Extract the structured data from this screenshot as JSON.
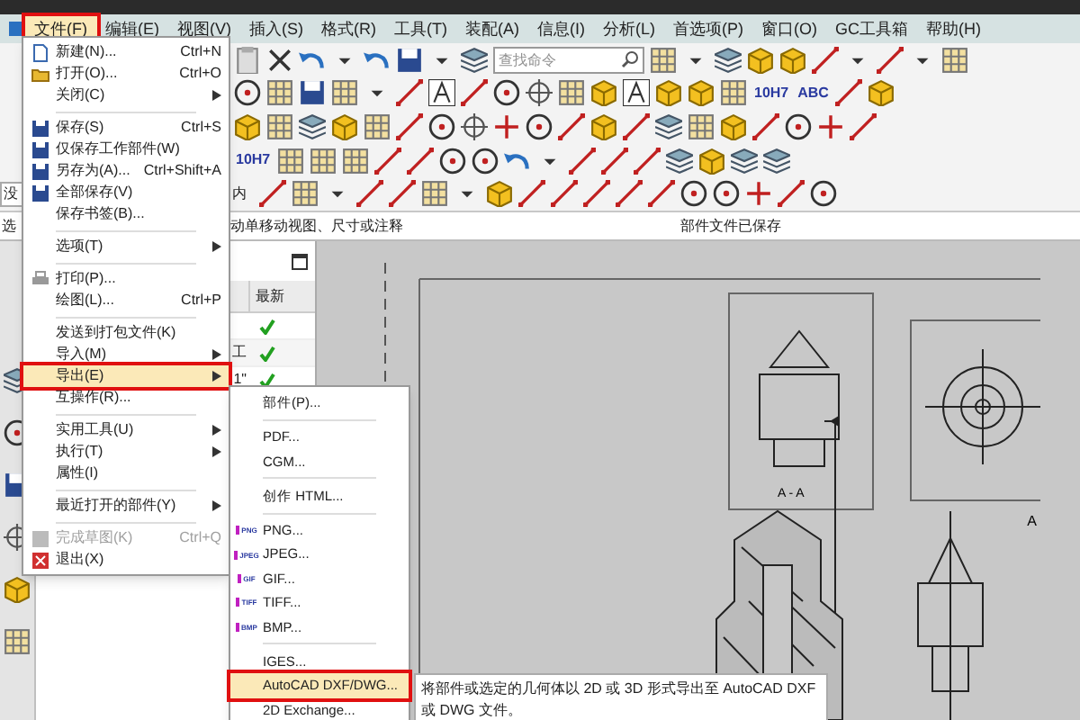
{
  "menu_bar": {
    "items": [
      {
        "label": "文件(F)",
        "selected": true,
        "highlight": true
      },
      {
        "label": "编辑(E)",
        "selected": false,
        "highlight": false
      },
      {
        "label": "视图(V)",
        "selected": false,
        "highlight": false
      },
      {
        "label": "插入(S)",
        "selected": false,
        "highlight": false
      },
      {
        "label": "格式(R)",
        "selected": false,
        "highlight": false
      },
      {
        "label": "工具(T)",
        "selected": false,
        "highlight": false
      },
      {
        "label": "装配(A)",
        "selected": false,
        "highlight": false
      },
      {
        "label": "信息(I)",
        "selected": false,
        "highlight": false
      },
      {
        "label": "分析(L)",
        "selected": false,
        "highlight": false
      },
      {
        "label": "首选项(P)",
        "selected": false,
        "highlight": false
      },
      {
        "label": "窗口(O)",
        "selected": false,
        "highlight": false
      },
      {
        "label": "GC工具箱",
        "selected": false,
        "highlight": false
      },
      {
        "label": "帮助(H)",
        "selected": false,
        "highlight": false
      }
    ]
  },
  "toolbar": {
    "search": {
      "placeholder": "查找命令"
    },
    "captions": [
      "10H7",
      "ABC",
      "10H7"
    ],
    "filter_value": "没",
    "scope_value": "内"
  },
  "status_bar": {
    "prompt_start": "选",
    "prompt": "动单移动视图、尺寸或注释",
    "message": "部件文件已保存"
  },
  "part_navigator": {
    "column": "最新",
    "rows": [
      {
        "latest": true
      },
      {
        "name": "工",
        "latest": true
      },
      {
        "name": "1\"",
        "latest": true
      }
    ]
  },
  "file_menu": {
    "items": [
      {
        "kind": "item",
        "label": "新建(N)...",
        "shortcut": "Ctrl+N",
        "submenu": false,
        "disabled": false,
        "selected": false,
        "highlight": false
      },
      {
        "kind": "item",
        "label": "打开(O)...",
        "shortcut": "Ctrl+O",
        "submenu": false,
        "disabled": false,
        "selected": false,
        "highlight": false
      },
      {
        "kind": "item",
        "label": "关闭(C)",
        "submenu": true,
        "disabled": false,
        "selected": false,
        "highlight": false
      },
      {
        "kind": "separator"
      },
      {
        "kind": "item",
        "label": "保存(S)",
        "shortcut": "Ctrl+S",
        "submenu": false,
        "disabled": false,
        "selected": false,
        "highlight": false
      },
      {
        "kind": "item",
        "label": "仅保存工作部件(W)",
        "submenu": false,
        "disabled": false,
        "selected": false,
        "highlight": false
      },
      {
        "kind": "item",
        "label": "另存为(A)...",
        "shortcut": "Ctrl+Shift+A",
        "submenu": false,
        "disabled": false,
        "selected": false,
        "highlight": false
      },
      {
        "kind": "item",
        "label": "全部保存(V)",
        "submenu": false,
        "disabled": false,
        "selected": false,
        "highlight": false
      },
      {
        "kind": "item",
        "label": "保存书签(B)...",
        "submenu": false,
        "disabled": false,
        "selected": false,
        "highlight": false
      },
      {
        "kind": "separator"
      },
      {
        "kind": "item",
        "label": "选项(T)",
        "submenu": true,
        "disabled": false,
        "selected": false,
        "highlight": false
      },
      {
        "kind": "separator"
      },
      {
        "kind": "item",
        "label": "打印(P)...",
        "submenu": false,
        "disabled": false,
        "selected": false,
        "highlight": false
      },
      {
        "kind": "item",
        "label": "绘图(L)...",
        "shortcut": "Ctrl+P",
        "submenu": false,
        "disabled": false,
        "selected": false,
        "highlight": false
      },
      {
        "kind": "separator"
      },
      {
        "kind": "item",
        "label": "发送到打包文件(K)",
        "submenu": false,
        "disabled": false,
        "selected": false,
        "highlight": false
      },
      {
        "kind": "item",
        "label": "导入(M)",
        "submenu": true,
        "disabled": false,
        "selected": false,
        "highlight": false
      },
      {
        "kind": "item",
        "label": "导出(E)",
        "submenu": true,
        "disabled": false,
        "selected": true,
        "highlight": true
      },
      {
        "kind": "item",
        "label": "互操作(R)...",
        "submenu": false,
        "disabled": false,
        "selected": false,
        "highlight": false
      },
      {
        "kind": "separator"
      },
      {
        "kind": "item",
        "label": "实用工具(U)",
        "submenu": true,
        "disabled": false,
        "selected": false,
        "highlight": false
      },
      {
        "kind": "item",
        "label": "执行(T)",
        "submenu": true,
        "disabled": false,
        "selected": false,
        "highlight": false
      },
      {
        "kind": "item",
        "label": "属性(I)",
        "submenu": false,
        "disabled": false,
        "selected": false,
        "highlight": false
      },
      {
        "kind": "separator"
      },
      {
        "kind": "item",
        "label": "最近打开的部件(Y)",
        "submenu": true,
        "disabled": false,
        "selected": false,
        "highlight": false
      },
      {
        "kind": "separator"
      },
      {
        "kind": "item",
        "label": "完成草图(K)",
        "shortcut": "Ctrl+Q",
        "submenu": false,
        "disabled": true,
        "selected": false,
        "highlight": false
      },
      {
        "kind": "item",
        "label": "退出(X)",
        "submenu": false,
        "disabled": false,
        "selected": false,
        "highlight": false
      }
    ]
  },
  "export_submenu": {
    "items": [
      {
        "kind": "item",
        "label": "部件(P)...",
        "selected": false,
        "highlight": false
      },
      {
        "kind": "separator"
      },
      {
        "kind": "item",
        "label": "PDF...",
        "selected": false,
        "highlight": false
      },
      {
        "kind": "item",
        "label": "CGM...",
        "selected": false,
        "highlight": false
      },
      {
        "kind": "separator"
      },
      {
        "kind": "item",
        "label": "创作 HTML...",
        "selected": false,
        "highlight": false
      },
      {
        "kind": "separator"
      },
      {
        "kind": "item",
        "label": "PNG...",
        "badge": "PNG",
        "selected": false,
        "highlight": false
      },
      {
        "kind": "item",
        "label": "JPEG...",
        "badge": "JPEG",
        "selected": false,
        "highlight": false
      },
      {
        "kind": "item",
        "label": "GIF...",
        "badge": "GIF",
        "selected": false,
        "highlight": false
      },
      {
        "kind": "item",
        "label": "TIFF...",
        "badge": "TIFF",
        "selected": false,
        "highlight": false
      },
      {
        "kind": "item",
        "label": "BMP...",
        "badge": "BMP",
        "selected": false,
        "highlight": false
      },
      {
        "kind": "separator"
      },
      {
        "kind": "item",
        "label": "IGES...",
        "selected": false,
        "highlight": false
      },
      {
        "kind": "item",
        "label": "AutoCAD DXF/DWG...",
        "selected": true,
        "highlight": true
      },
      {
        "kind": "item",
        "label": "2D Exchange...",
        "selected": false,
        "highlight": false
      }
    ]
  },
  "tooltip": {
    "text": "将部件或选定的几何体以 2D 或 3D 形式导出至 AutoCAD DXF 或 DWG 文件。"
  },
  "drawing": {
    "section_label": "A - A",
    "view_label": "A"
  }
}
